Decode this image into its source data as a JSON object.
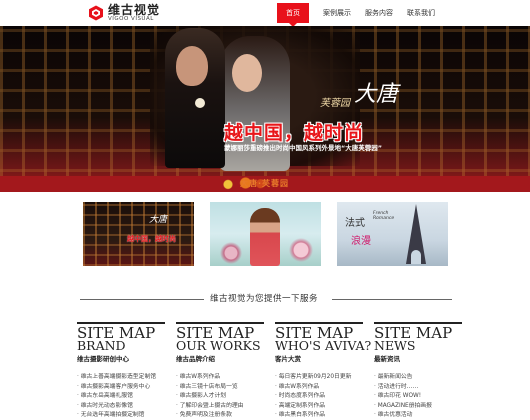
{
  "header": {
    "logo_cn": "维古视觉",
    "logo_en": "VIGOO VISUAL",
    "nav": [
      "首页",
      "案例展示",
      "服务内容",
      "联系我们"
    ],
    "accent": "#e8111b"
  },
  "banner": {
    "tang_title": "大唐",
    "tang_sub": "芙蓉园",
    "slogan": "越中国，越时尚",
    "sub_slogan": "蒙娜丽莎重磅推出时尚中国风系列外景地“大唐芙蓉园”",
    "strip_text": "大唐·芙蓉园"
  },
  "thumbs": {
    "t1_slogan": "越中国，越时尚",
    "t1_cn": "大唐",
    "t3_cn1": "法式",
    "t3_cn2": "浪漫",
    "t3_en": "French\nRomance"
  },
  "section": {
    "title": "维古视觉为您提供一下服务"
  },
  "columns": [
    {
      "site_map": "SITE MAP",
      "en": "BRAND",
      "cn": "维古摄影研创中心",
      "items": [
        "维古上善高端摄影造型定制馆",
        "维古摄影高端客户服务中心",
        "维古东岳高端礼服馆",
        "维古时光动态影像馆",
        "无台选年高端拍摄定制馆"
      ]
    },
    {
      "site_map": "SITE MAP",
      "en": "OUR WORKS",
      "cn": "维古品牌介绍",
      "items": [
        "维古W系列作品",
        "维古三镜十店布局一览",
        "维古摄影人才计划",
        "了解印会暨上摄古的理由",
        "免费声明及注册条款"
      ]
    },
    {
      "site_map": "SITE MAP",
      "en": "WHO'S AVIVA?",
      "cn": "客片大赏",
      "items": [
        "每日客片更新09月20日更新",
        "维古W系列作品",
        "时尚态度系列作品",
        "高端定制系列作品",
        "维古黑白系列作品"
      ]
    },
    {
      "site_map": "SITE MAP",
      "en": "NEWS",
      "cn": "最新资讯",
      "items": [
        "最新新闻公告",
        "活动进行时……",
        "维古印花 WOW!",
        "MAGAZINE册拍画报",
        "维古优惠活动"
      ]
    }
  ]
}
